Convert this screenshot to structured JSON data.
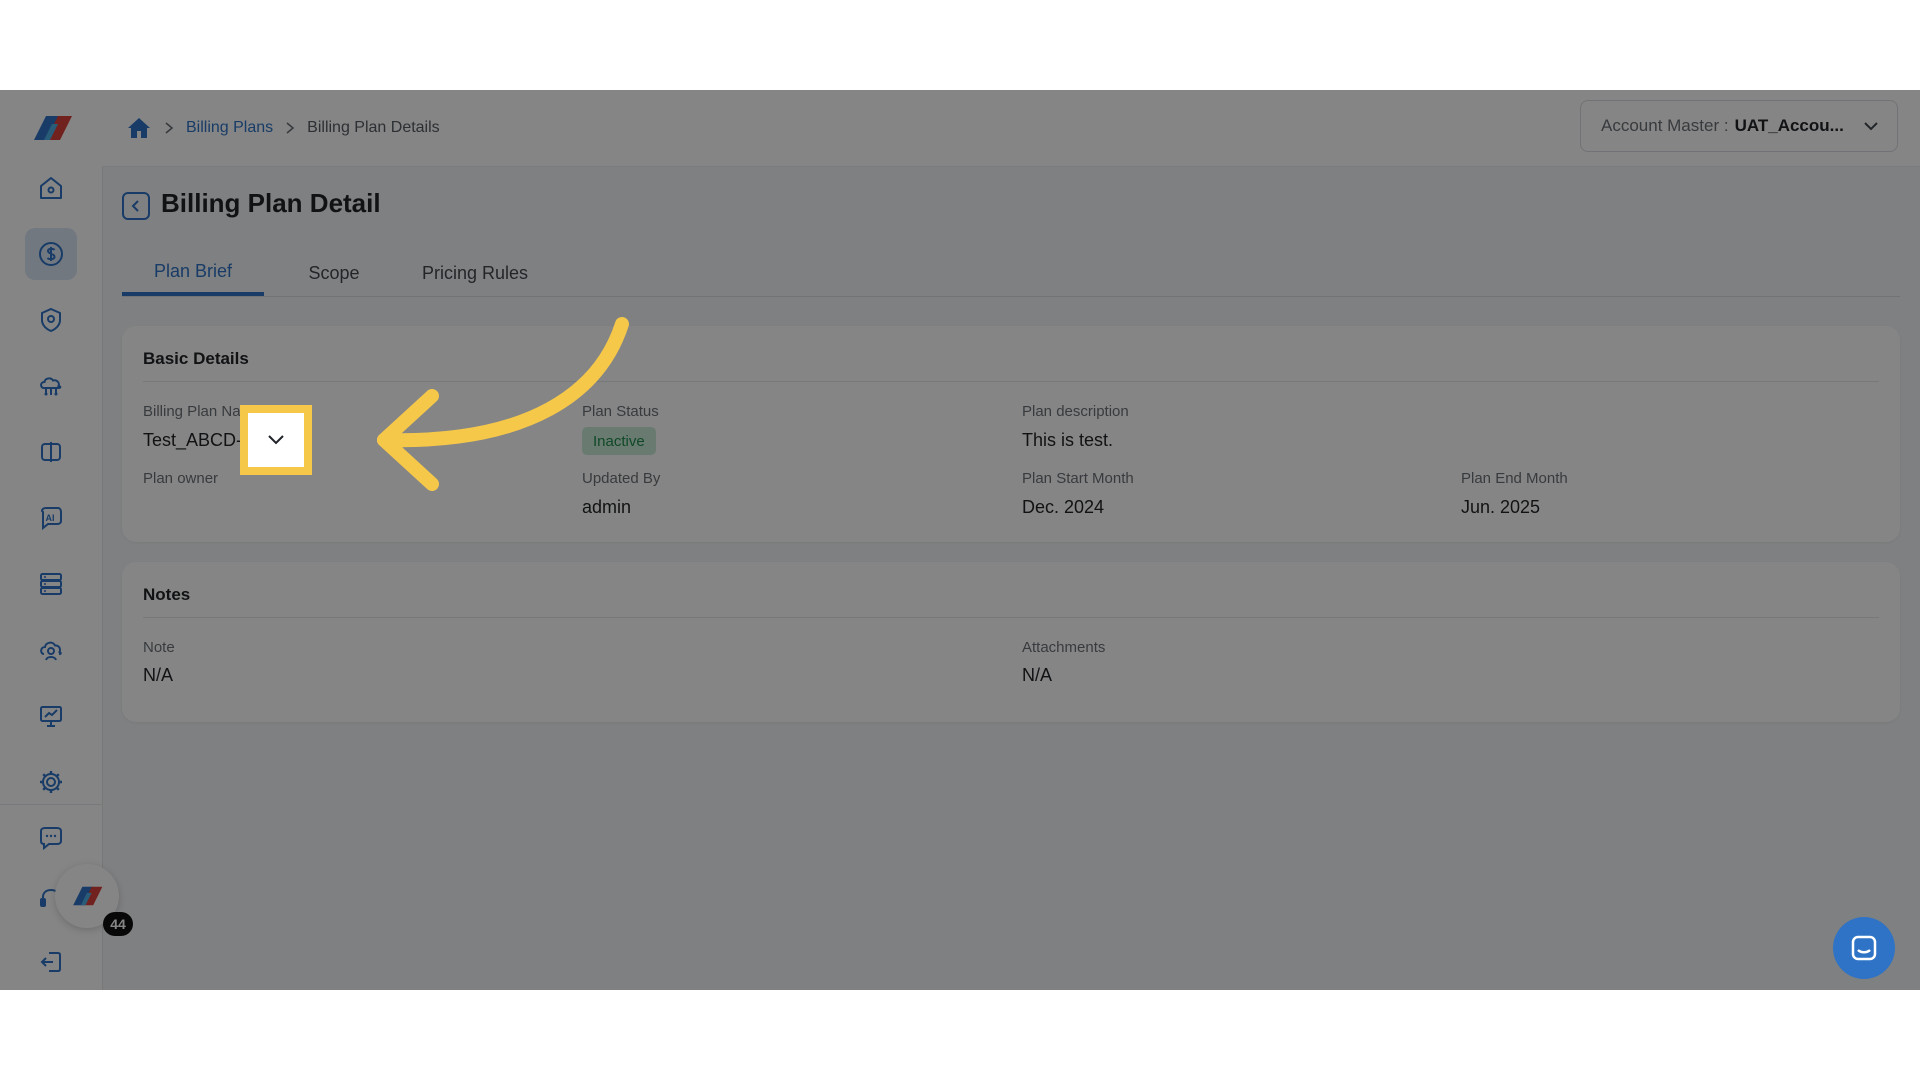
{
  "breadcrumb": {
    "items": [
      "Billing Plans",
      "Billing Plan Details"
    ]
  },
  "account": {
    "label": "Account Master :",
    "value": "UAT_Accou..."
  },
  "page": {
    "title": "Billing Plan Detail"
  },
  "tabs": [
    {
      "label": "Plan Brief",
      "active": true
    },
    {
      "label": "Scope",
      "active": false
    },
    {
      "label": "Pricing Rules",
      "active": false
    }
  ],
  "basic_details": {
    "title": "Basic Details",
    "billing_plan_name_label": "Billing Plan Name",
    "billing_plan_name_value": "Test_ABCD-1",
    "plan_status_label": "Plan Status",
    "plan_status_value": "Inactive",
    "plan_description_label": "Plan description",
    "plan_description_value": "This is test.",
    "plan_owner_label": "Plan owner",
    "updated_by_label": "Updated By",
    "updated_by_value": "admin",
    "plan_start_month_label": "Plan Start Month",
    "plan_start_month_value": "Dec. 2024",
    "plan_end_month_label": "Plan End Month",
    "plan_end_month_value": "Jun. 2025"
  },
  "notes": {
    "title": "Notes",
    "note_label": "Note",
    "note_value": "N/A",
    "attachments_label": "Attachments",
    "attachments_value": "N/A"
  },
  "fab": {
    "badge_count": "44"
  },
  "colors": {
    "accent": "#2f73c6",
    "highlight": "#f6c84a",
    "status_inactive_bg": "#c9ecd6",
    "status_inactive_text": "#1f8a4c"
  },
  "icons": {
    "sidebar": [
      "home-icon",
      "dollar-icon",
      "shield-location-icon",
      "cloud-network-icon",
      "compare-icon",
      "ai-chat-icon",
      "server-icon",
      "cloud-user-icon",
      "presentation-chart-icon",
      "gear-icon",
      "message-icon",
      "support-icon",
      "logout-icon"
    ]
  }
}
